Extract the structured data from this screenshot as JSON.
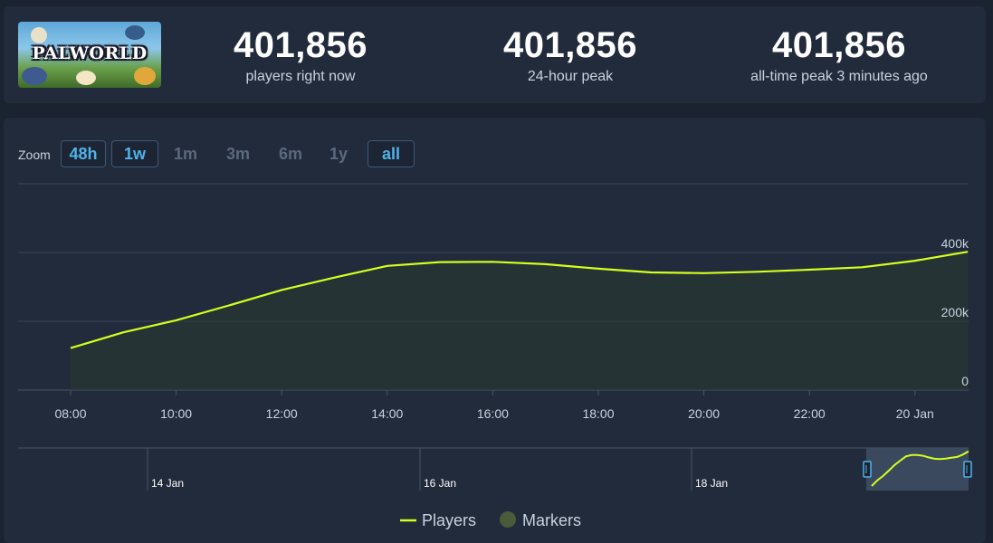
{
  "game": {
    "logo_text": "PALWORLD",
    "logo_icon": "palworld-logo-image"
  },
  "stats": [
    {
      "value": "401,856",
      "label": "players right now"
    },
    {
      "value": "401,856",
      "label": "24-hour peak"
    },
    {
      "value": "401,856",
      "label": "all-time peak 3 minutes ago"
    }
  ],
  "zoom": {
    "label": "Zoom",
    "options": [
      {
        "label": "48h",
        "state": "active"
      },
      {
        "label": "1w",
        "state": "active"
      },
      {
        "label": "1m",
        "state": "disabled"
      },
      {
        "label": "3m",
        "state": "disabled"
      },
      {
        "label": "6m",
        "state": "disabled"
      },
      {
        "label": "1y",
        "state": "disabled"
      },
      {
        "label": "all",
        "state": "active"
      }
    ]
  },
  "colors": {
    "series_line": "#d4ff1f",
    "series_fill": "#2a3a2f",
    "markers": "#4a5a3a",
    "accent": "#4fb3ea",
    "background": "#1b2230",
    "panel": "#222b3b"
  },
  "chart_data": {
    "type": "line",
    "x_labels": [
      "08:00",
      "10:00",
      "12:00",
      "14:00",
      "16:00",
      "18:00",
      "20:00",
      "22:00",
      "20 Jan"
    ],
    "ylim": [
      0,
      400000
    ],
    "y_ticks": [
      {
        "value": 0,
        "label": "0"
      },
      {
        "value": 200000,
        "label": "200k"
      },
      {
        "value": 400000,
        "label": "400k"
      }
    ],
    "series": [
      {
        "name": "Players",
        "x": [
          "08:00",
          "09:00",
          "10:00",
          "11:00",
          "12:00",
          "13:00",
          "14:00",
          "15:00",
          "16:00",
          "17:00",
          "18:00",
          "19:00",
          "20:00",
          "21:00",
          "22:00",
          "23:00",
          "20 Jan 00:00",
          "20 Jan 01:00"
        ],
        "y": [
          122000,
          168000,
          203000,
          246000,
          291000,
          327000,
          361000,
          372000,
          373000,
          366000,
          353000,
          342000,
          340000,
          344000,
          350000,
          357000,
          376000,
          402000
        ]
      }
    ],
    "navigator": {
      "labels": [
        "14 Jan",
        "16 Jan",
        "18 Jan"
      ]
    },
    "legend": [
      "Players",
      "Markers"
    ],
    "legend_position": "bottom-center"
  }
}
